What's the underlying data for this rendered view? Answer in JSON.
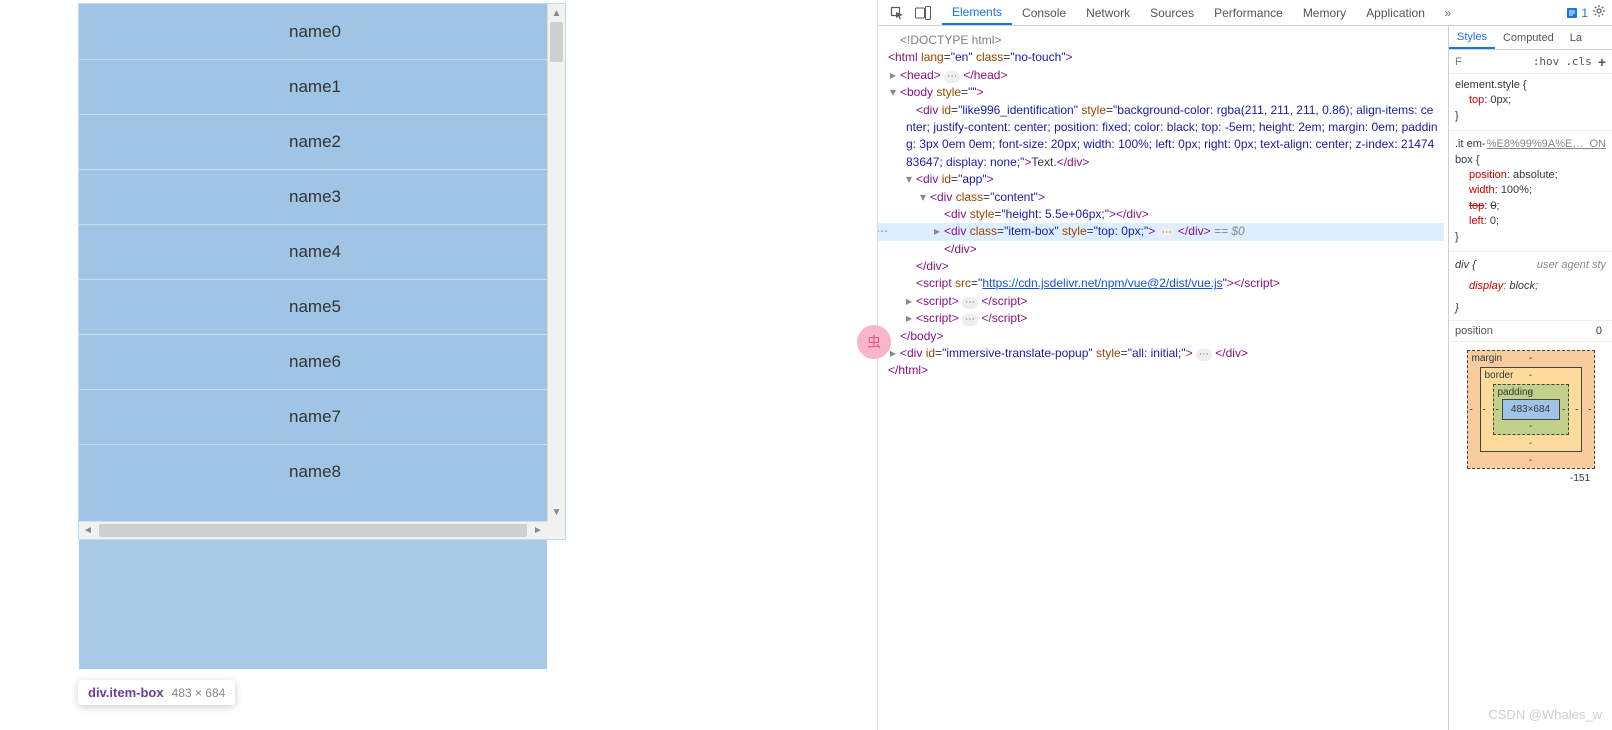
{
  "left_panel": {
    "items": [
      "name0",
      "name1",
      "name2",
      "name3",
      "name4",
      "name5",
      "name6",
      "name7",
      "name8"
    ],
    "highlight_size": "483×684",
    "tooltip_selector": "div.item-box",
    "tooltip_dim": "483 × 684"
  },
  "devtools": {
    "tabs": [
      "Elements",
      "Console",
      "Network",
      "Sources",
      "Performance",
      "Memory",
      "Application"
    ],
    "active_tab": "Elements",
    "issues_count": "1",
    "styles_tabs": [
      "Styles",
      "Computed",
      "La"
    ],
    "active_styles_tab": "Styles",
    "filter_placeholder": "F",
    "hov": ":hov",
    "cls": ".cls",
    "dom": {
      "doctype": "<!DOCTYPE html>",
      "html_open": {
        "tag": "html",
        "attrs": [
          [
            "lang",
            "en"
          ],
          [
            "class",
            "no-touch"
          ]
        ]
      },
      "head_open": {
        "tag": "head"
      },
      "body_open": {
        "tag": "body",
        "attrs": [
          [
            "style",
            ""
          ]
        ]
      },
      "overlay_div": {
        "tag": "div",
        "attrs": [
          [
            "id",
            "like996_identification"
          ],
          [
            "style",
            "background-color: rgba(211, 211, 211, 0.86); align-items: center; justify-content: center; position: fixed; color: black; top: -5em; height: 2em; margin: 0em; padding: 3px 0em 0em; font-size: 20px; width: 100%; left: 0px; right: 0px; text-align: center; z-index: 2147483647; display: none;"
          ]
        ],
        "text": "Text."
      },
      "app_div": {
        "tag": "div",
        "attrs": [
          [
            "id",
            "app"
          ]
        ]
      },
      "content_div": {
        "tag": "div",
        "attrs": [
          [
            "class",
            "content"
          ]
        ]
      },
      "spacer_div": {
        "tag": "div",
        "attrs": [
          [
            "style",
            "height: 5.5e+06px;"
          ]
        ]
      },
      "itembox_div": {
        "tag": "div",
        "attrs": [
          [
            "class",
            "item-box"
          ],
          [
            "style",
            "top: 0px;"
          ]
        ],
        "eq0": "== $0"
      },
      "script1": {
        "tag": "script",
        "src": "https://cdn.jsdelivr.net/npm/vue@2/dist/vue.js"
      },
      "script_plain": {
        "tag": "script"
      },
      "popup_div": {
        "tag": "div",
        "attrs": [
          [
            "id",
            "immersive-translate-popup"
          ],
          [
            "style",
            "all: initial;"
          ]
        ]
      }
    },
    "styles": {
      "element_style_label": "element.style",
      "element_style_props": [
        [
          "top",
          "0px"
        ]
      ],
      "rule2_selector": ".it em-box",
      "rule2_src": "%E8%99%9A%E…_ON",
      "rule2_props": [
        [
          "position",
          "absolute",
          false
        ],
        [
          "width",
          "100%",
          false
        ],
        [
          "top",
          "0",
          true
        ],
        [
          "left",
          "0",
          false
        ]
      ],
      "ua_selector": "div",
      "ua_src": "user agent sty",
      "ua_props": [
        [
          "display",
          "block"
        ]
      ]
    },
    "metrics": {
      "header": "position",
      "header_val": "0",
      "margin_label": "margin",
      "border_label": "border",
      "padding_label": "padding",
      "dash": "-",
      "content": "483×684",
      "outside_bottom": "-151"
    }
  },
  "watermark": "CSDN @Whales_w"
}
